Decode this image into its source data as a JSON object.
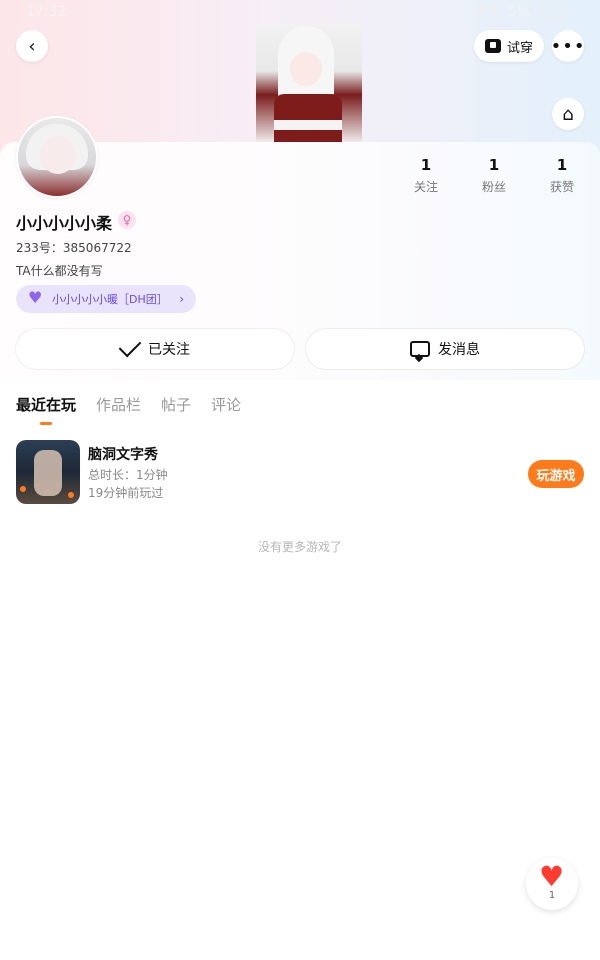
{
  "status": {
    "time": "17:32",
    "battery": "5%"
  },
  "top_actions": {
    "try_on": "试穿"
  },
  "profile": {
    "nickname": "小小小小小柔",
    "id_text": "233号：385067722",
    "bio": "TA什么都没有写",
    "team": "小小小小小暖［DH团］",
    "stats": [
      {
        "value": "1",
        "label": "关注"
      },
      {
        "value": "1",
        "label": "粉丝"
      },
      {
        "value": "1",
        "label": "获赞"
      }
    ],
    "actions": {
      "follow": "已关注",
      "message": "发消息"
    }
  },
  "tabs": [
    {
      "label": "最近在玩",
      "active": true
    },
    {
      "label": "作品栏",
      "active": false
    },
    {
      "label": "帖子",
      "active": false
    },
    {
      "label": "评论",
      "active": false
    }
  ],
  "recent_games": [
    {
      "title": "脑洞文字秀",
      "duration": "总时长：1分钟",
      "last_played": "19分钟前玩过",
      "play_label": "玩游戏"
    }
  ],
  "no_more_text": "没有更多游戏了",
  "like_fab": {
    "count": "1"
  },
  "colors": {
    "accent": "#ff7a1a",
    "team": "#6a4bd8"
  }
}
